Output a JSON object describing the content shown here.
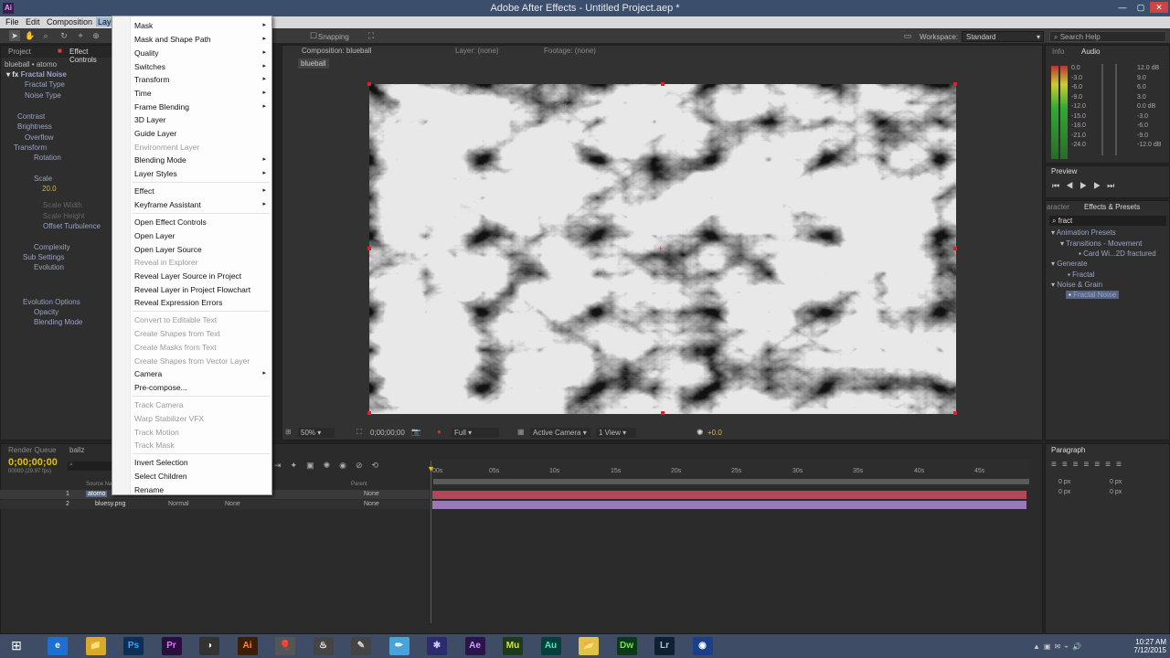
{
  "window": {
    "title": "Adobe After Effects - Untitled Project.aep *",
    "app_icon": "Ai"
  },
  "menubar": {
    "items": [
      "File",
      "Edit",
      "Composition",
      "Layer"
    ]
  },
  "toolbar": {
    "snapping": "Snapping",
    "workspace_label": "Workspace:",
    "workspace_value": "Standard",
    "search_placeholder": "Search Help"
  },
  "left_panel": {
    "tabs": [
      "Project",
      "Effect Controls"
    ],
    "breadcrumb": "blueball • atomo",
    "effect_name": "Fractal Noise",
    "props": [
      "Fractal Type",
      "Noise Type",
      "Contrast",
      "Brightness",
      "Overflow",
      "Transform",
      "Rotation",
      "Scale",
      "20.0",
      "Scale Width",
      "Scale Height",
      "Offset Turbulence",
      "Complexity",
      "Sub Settings",
      "Evolution",
      "Evolution Options",
      "Opacity",
      "Blending Mode"
    ]
  },
  "layer_menu": {
    "items": [
      {
        "label": "Mask",
        "sub": true
      },
      {
        "label": "Mask and Shape Path",
        "sub": true
      },
      {
        "label": "Quality",
        "sub": true
      },
      {
        "label": "Switches",
        "sub": true
      },
      {
        "label": "Transform",
        "sub": true
      },
      {
        "label": "Time",
        "sub": true
      },
      {
        "label": "Frame Blending",
        "sub": true
      },
      {
        "label": "3D Layer"
      },
      {
        "label": "Guide Layer"
      },
      {
        "label": "Environment Layer",
        "disabled": true
      },
      {
        "label": "Blending Mode",
        "sub": true
      },
      {
        "label": "Layer Styles",
        "sub": true
      },
      {
        "label": "Effect",
        "sub": true
      },
      {
        "label": "Keyframe Assistant",
        "sub": true
      },
      {
        "label": "Open Effect Controls"
      },
      {
        "label": "Open Layer"
      },
      {
        "label": "Open Layer Source"
      },
      {
        "label": "Reveal in Explorer",
        "disabled": true
      },
      {
        "label": "Reveal Layer Source in Project"
      },
      {
        "label": "Reveal Layer in Project Flowchart"
      },
      {
        "label": "Reveal Expression Errors"
      },
      {
        "label": "Convert to Editable Text",
        "disabled": true
      },
      {
        "label": "Create Shapes from Text",
        "disabled": true
      },
      {
        "label": "Create Masks from Text",
        "disabled": true
      },
      {
        "label": "Create Shapes from Vector Layer",
        "disabled": true
      },
      {
        "label": "Camera",
        "sub": true
      },
      {
        "label": "Pre-compose..."
      },
      {
        "label": "Track Camera",
        "disabled": true
      },
      {
        "label": "Warp Stabilizer VFX",
        "disabled": true
      },
      {
        "label": "Track Motion",
        "disabled": true
      },
      {
        "label": "Track Mask",
        "disabled": true
      },
      {
        "label": "Invert Selection"
      },
      {
        "label": "Select Children"
      },
      {
        "label": "Rename"
      }
    ]
  },
  "viewer": {
    "tab": "Composition: blueball",
    "layer_tab": "Layer: (none)",
    "footage_tab": "Footage: (none)",
    "comp_name": "blueball",
    "zoom": "50%",
    "timecode": "0;00;00;00",
    "resolution": "Full",
    "camera": "Active Camera",
    "view": "1 View",
    "exposure": "+0.0"
  },
  "info_panel": {
    "tabs": [
      "Info",
      "Audio"
    ],
    "db_left": [
      "0.0",
      "-3.0",
      "-6.0",
      "-9.0",
      "-12.0",
      "-15.0",
      "-18.0",
      "-21.0",
      "-24.0"
    ],
    "db_right": [
      "12.0 dB",
      "9.0",
      "6.0",
      "3.0",
      "0.0 dB",
      "-3.0",
      "-6.0",
      "-9.0",
      "-12.0 dB"
    ]
  },
  "preview_panel": {
    "tab": "Preview"
  },
  "effects_panel": {
    "tabs": [
      "aracter",
      "Effects & Presets"
    ],
    "search": "fract",
    "tree": [
      "Animation Presets",
      "Transitions - Movement",
      "Card Wi...2D fractured",
      "Generate",
      "Fractal",
      "Noise & Grain",
      "Fractal Noise"
    ]
  },
  "timeline": {
    "tabs": [
      "Render Queue",
      "ballz"
    ],
    "timecode": "0;00;00;00",
    "fps": "00000 (29.97 fps)",
    "search_placeholder": "",
    "col_source": "Source Name",
    "col_parent": "Parent",
    "ticks": [
      "00s",
      "05s",
      "10s",
      "15s",
      "20s",
      "25s",
      "30s",
      "35s",
      "40s",
      "45s"
    ],
    "layers": [
      {
        "num": "1",
        "name": "atomo",
        "mode": "Normal",
        "trkmat": "",
        "parent": "None"
      },
      {
        "num": "2",
        "name": "bluesy.png",
        "mode": "Normal",
        "trkmat": "None",
        "parent": "None"
      }
    ]
  },
  "paragraph_panel": {
    "tab": "Paragraph",
    "fields": [
      "0 px",
      "0 px",
      "0 px",
      "0 px",
      "0 px"
    ]
  },
  "taskbar": {
    "time": "10:27 AM",
    "date": "7/12/2015",
    "apps": [
      "e",
      "📁",
      "Ps",
      "Pr",
      "◑",
      "Ai",
      "🎈",
      "♨",
      "✎",
      "✏",
      "✱",
      "Ae",
      "Mu",
      "Au",
      "📂",
      "Dw",
      "Lr",
      "◉"
    ]
  }
}
